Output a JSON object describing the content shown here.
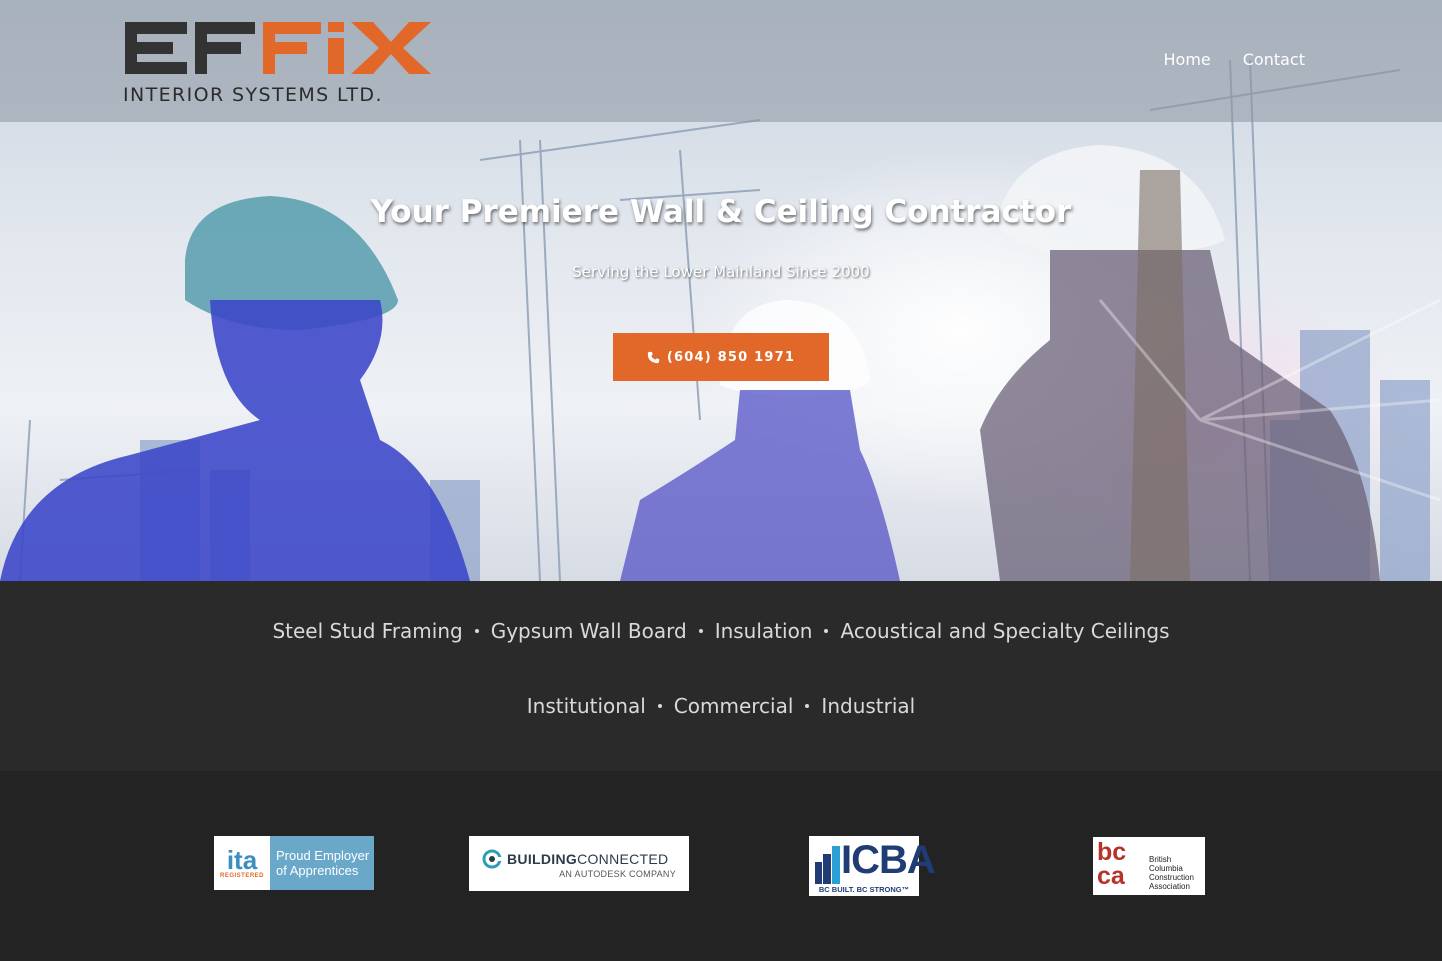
{
  "brand": {
    "wordmark": "EFFIX",
    "subtitle": "INTERIOR SYSTEMS LTD.",
    "colors": {
      "dark": "#333333",
      "orange": "#e2682a"
    }
  },
  "nav": {
    "items": [
      {
        "label": "Home"
      },
      {
        "label": "Contact"
      }
    ]
  },
  "hero": {
    "title": "Your Premiere Wall & Ceiling Contractor",
    "subtitle": "Serving the Lower Mainland Since 2000",
    "phone_button": {
      "icon": "phone-icon",
      "label": "(604) 850 1971",
      "color": "#e2682a"
    }
  },
  "services": {
    "line1": [
      "Steel Stud Framing",
      "Gypsum Wall Board",
      "Insulation",
      "Acoustical and Specialty Ceilings"
    ],
    "line2": [
      "Institutional",
      "Commercial",
      "Industrial"
    ]
  },
  "badges": {
    "ita": {
      "logo": "ita",
      "registered": "REGISTERED",
      "line1": "Proud Employer",
      "line2": "of Apprentices"
    },
    "building_connected": {
      "bold": "BUILDING",
      "light": "CONNECTED",
      "sub": "AN AUTODESK COMPANY"
    },
    "icba": {
      "name": "ICBA",
      "tagline": "BC BUILT. BC STRONG™"
    },
    "bcca": {
      "mark_top": "bc",
      "mark_bottom": "ca",
      "line1": "British",
      "line2": "Columbia",
      "line3": "Construction",
      "line4": "Association"
    }
  }
}
